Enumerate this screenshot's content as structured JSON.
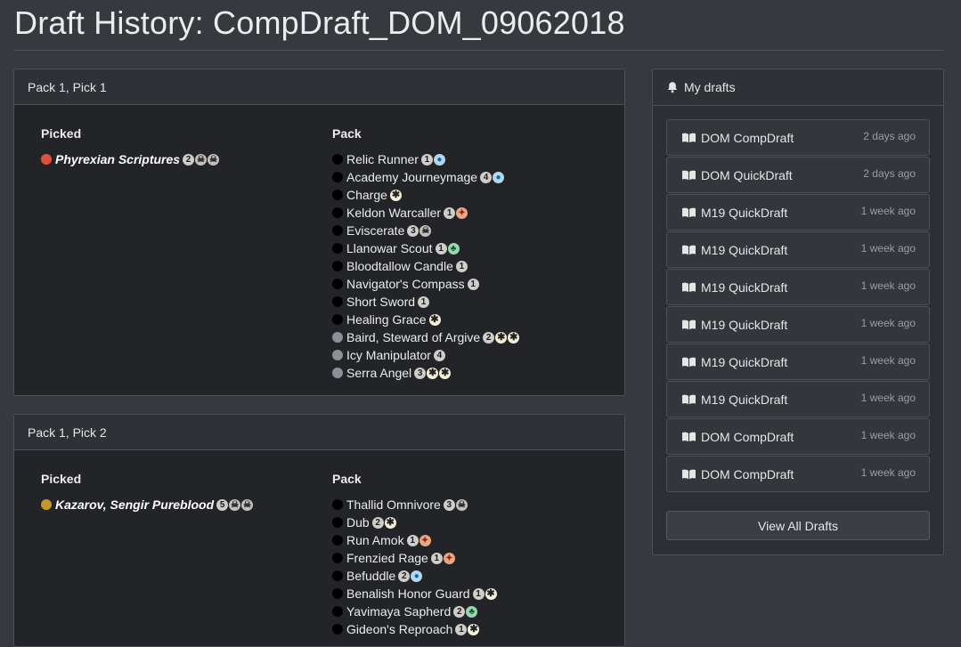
{
  "page": {
    "title": "Draft History: CompDraft_DOM_09062018"
  },
  "colors": {
    "red": "#e0503c",
    "gold": "#c4962e",
    "black": "#000000",
    "gray": "#8a9096"
  },
  "picks": [
    {
      "heading": "Pack 1, Pick 1",
      "picked_label": "Picked",
      "pack_label": "Pack",
      "picked": {
        "name": "Phyrexian Scriptures",
        "color": "red",
        "mana": [
          "2",
          "B",
          "B"
        ]
      },
      "pack": [
        {
          "name": "Relic Runner",
          "color": "black",
          "mana": [
            "1",
            "U"
          ]
        },
        {
          "name": "Academy Journeymage",
          "color": "black",
          "mana": [
            "4",
            "U"
          ]
        },
        {
          "name": "Charge",
          "color": "black",
          "mana": [
            "W"
          ]
        },
        {
          "name": "Keldon Warcaller",
          "color": "black",
          "mana": [
            "1",
            "R"
          ]
        },
        {
          "name": "Eviscerate",
          "color": "black",
          "mana": [
            "3",
            "B"
          ]
        },
        {
          "name": "Llanowar Scout",
          "color": "black",
          "mana": [
            "1",
            "G"
          ]
        },
        {
          "name": "Bloodtallow Candle",
          "color": "black",
          "mana": [
            "1"
          ]
        },
        {
          "name": "Navigator's Compass",
          "color": "black",
          "mana": [
            "1"
          ]
        },
        {
          "name": "Short Sword",
          "color": "black",
          "mana": [
            "1"
          ]
        },
        {
          "name": "Healing Grace",
          "color": "black",
          "mana": [
            "W"
          ]
        },
        {
          "name": "Baird, Steward of Argive",
          "color": "gray",
          "mana": [
            "2",
            "W",
            "W"
          ]
        },
        {
          "name": "Icy Manipulator",
          "color": "gray",
          "mana": [
            "4"
          ]
        },
        {
          "name": "Serra Angel",
          "color": "gray",
          "mana": [
            "3",
            "W",
            "W"
          ]
        }
      ]
    },
    {
      "heading": "Pack 1, Pick 2",
      "picked_label": "Picked",
      "pack_label": "Pack",
      "picked": {
        "name": "Kazarov, Sengir Pureblood",
        "color": "gold",
        "mana": [
          "5",
          "B",
          "B"
        ]
      },
      "pack": [
        {
          "name": "Thallid Omnivore",
          "color": "black",
          "mana": [
            "3",
            "B"
          ]
        },
        {
          "name": "Dub",
          "color": "black",
          "mana": [
            "2",
            "W"
          ]
        },
        {
          "name": "Run Amok",
          "color": "black",
          "mana": [
            "1",
            "R"
          ]
        },
        {
          "name": "Frenzied Rage",
          "color": "black",
          "mana": [
            "1",
            "R"
          ]
        },
        {
          "name": "Befuddle",
          "color": "black",
          "mana": [
            "2",
            "U"
          ]
        },
        {
          "name": "Benalish Honor Guard",
          "color": "black",
          "mana": [
            "1",
            "W"
          ]
        },
        {
          "name": "Yavimaya Sapherd",
          "color": "black",
          "mana": [
            "2",
            "G"
          ]
        },
        {
          "name": "Gideon's Reproach",
          "color": "black",
          "mana": [
            "1",
            "W"
          ]
        }
      ]
    }
  ],
  "sidebar": {
    "heading": "My drafts",
    "drafts": [
      {
        "name": "DOM CompDraft",
        "time": "2 days ago"
      },
      {
        "name": "DOM QuickDraft",
        "time": "2 days ago"
      },
      {
        "name": "M19 QuickDraft",
        "time": "1 week ago"
      },
      {
        "name": "M19 QuickDraft",
        "time": "1 week ago"
      },
      {
        "name": "M19 QuickDraft",
        "time": "1 week ago"
      },
      {
        "name": "M19 QuickDraft",
        "time": "1 week ago"
      },
      {
        "name": "M19 QuickDraft",
        "time": "1 week ago"
      },
      {
        "name": "M19 QuickDraft",
        "time": "1 week ago"
      },
      {
        "name": "DOM CompDraft",
        "time": "1 week ago"
      },
      {
        "name": "DOM CompDraft",
        "time": "1 week ago"
      }
    ],
    "view_all_label": "View All Drafts"
  }
}
